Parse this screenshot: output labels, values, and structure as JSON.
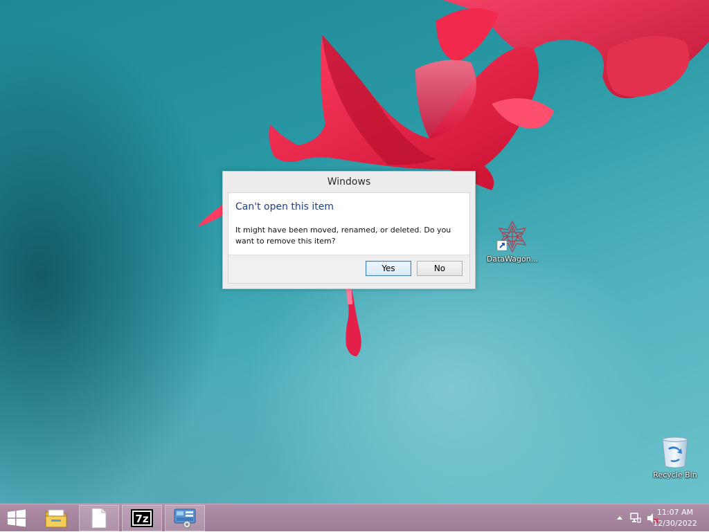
{
  "desktop": {
    "icons": [
      {
        "label": "DataWagon...",
        "icon": "datawagon-shortcut-icon"
      },
      {
        "label": "Recycle Bin",
        "icon": "recycle-bin-icon"
      }
    ]
  },
  "dialog": {
    "title": "Windows",
    "heading": "Can't open this item",
    "message": "It might have been moved, renamed, or deleted. Do you want to remove this item?",
    "yes_label": "Yes",
    "no_label": "No"
  },
  "taskbar": {
    "apps": [
      {
        "icon": "start-icon"
      },
      {
        "icon": "file-explorer-icon"
      },
      {
        "icon": "blank-document-icon"
      },
      {
        "icon": "7zip-icon",
        "text": "7z"
      },
      {
        "icon": "control-panel-icon"
      }
    ],
    "tray": {
      "icons": [
        "show-hidden-icons-chevron-icon",
        "network-icon",
        "volume-muted-icon"
      ]
    },
    "clock": {
      "time": "11:07 AM",
      "date": "12/30/2022"
    }
  },
  "colors": {
    "accent": "#1e3f8f",
    "taskbar": "#a98aa2",
    "desktop": "#2a98a4",
    "flower": "#e0213f"
  }
}
